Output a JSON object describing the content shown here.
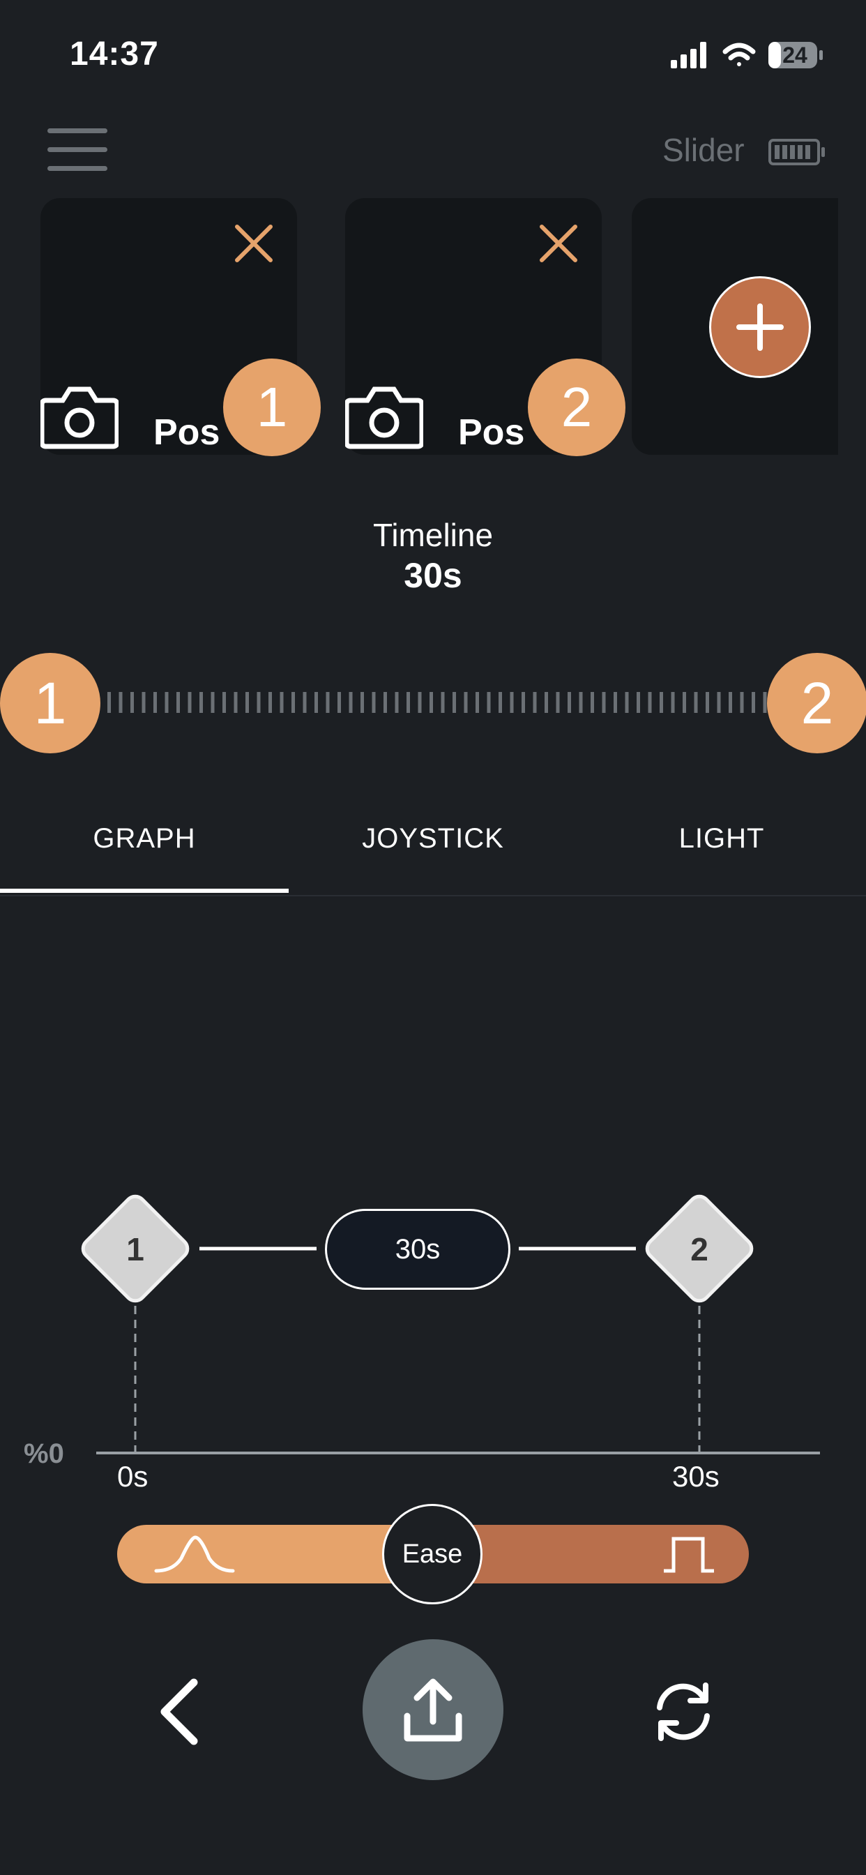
{
  "status_bar": {
    "time": "14:37",
    "battery_level": "24"
  },
  "header": {
    "device_name": "Slider"
  },
  "positions": [
    {
      "label": "Pos",
      "badge": "1"
    },
    {
      "label": "Pos",
      "badge": "2"
    }
  ],
  "timeline": {
    "title": "Timeline",
    "duration": "30s",
    "start_node": "1",
    "end_node": "2"
  },
  "tabs": [
    {
      "label": "GRAPH",
      "active": true
    },
    {
      "label": "JOYSTICK",
      "active": false
    },
    {
      "label": "LIGHT",
      "active": false
    }
  ],
  "graph": {
    "keyframes": [
      "1",
      "2"
    ],
    "segment_duration": "30s",
    "y_axis_label": "%0",
    "x_axis_labels": [
      "0s",
      "30s"
    ]
  },
  "ease": {
    "label": "Ease"
  },
  "colors": {
    "accent": "#e6a36b",
    "accent_dark": "#b96f4c",
    "background": "#1c1f23",
    "card": "#131619"
  },
  "icons": [
    "signal-icon",
    "wifi-icon",
    "battery-icon",
    "menu-icon",
    "close-icon",
    "camera-icon",
    "plus-icon",
    "bell-curve-icon",
    "square-pulse-icon",
    "chevron-left-icon",
    "upload-icon",
    "refresh-icon"
  ]
}
